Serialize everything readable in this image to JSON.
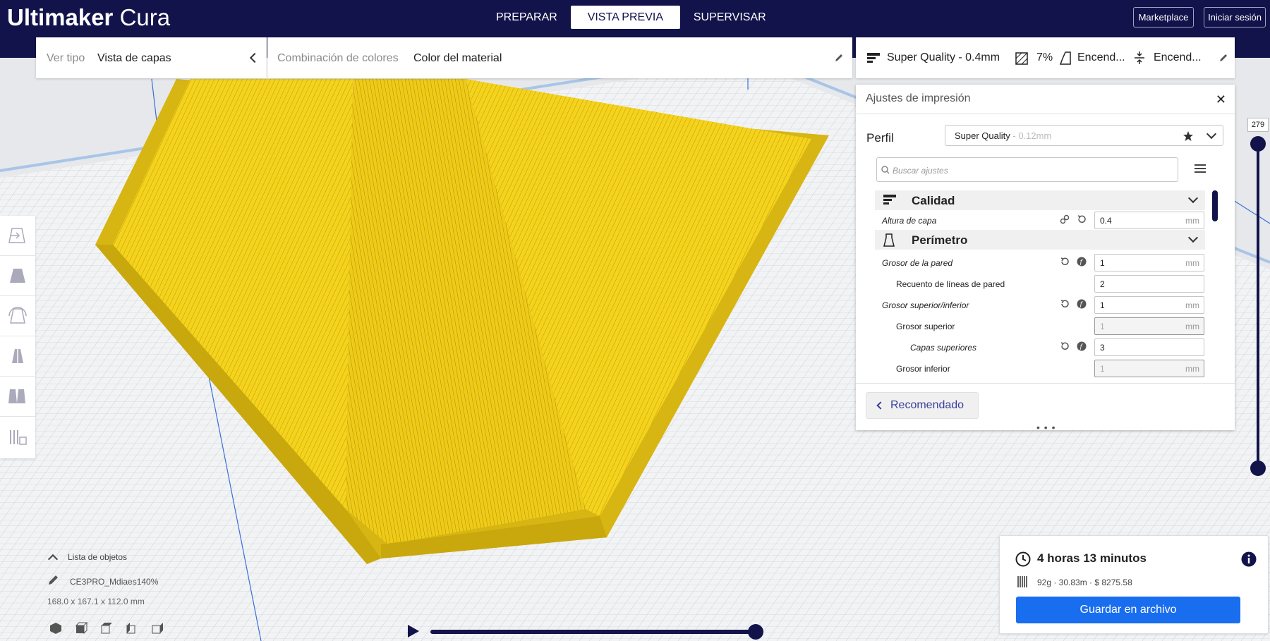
{
  "app": {
    "title_bold": "Ultimaker",
    "title_light": " Cura"
  },
  "stages": [
    {
      "label": "PREPARAR"
    },
    {
      "label": "VISTA PREVIA"
    },
    {
      "label": "SUPERVISAR"
    }
  ],
  "top_buttons": {
    "marketplace": "Marketplace",
    "login": "Iniciar sesión"
  },
  "view": {
    "type_label": "Ver tipo",
    "type_value": "Vista de capas",
    "color_label": "Combinación de colores",
    "color_value": "Color del material"
  },
  "print_setup_bar": {
    "profile": "Super Quality - 0.4mm",
    "infill": "7%",
    "support": "Encend...",
    "adhesion": "Encend..."
  },
  "print_settings": {
    "title": "Ajustes de impresión",
    "profile_label": "Perfil",
    "profile_name": "Super Quality",
    "profile_sub": " - 0.12mm",
    "search_placeholder": "Buscar ajustes",
    "categories": [
      {
        "label": "Calidad"
      },
      {
        "label": "Perímetro"
      }
    ],
    "settings": [
      {
        "label": "Altura de capa",
        "value": "0.4",
        "unit": "mm"
      },
      {
        "label": "Grosor de la pared",
        "value": "1",
        "unit": "mm"
      },
      {
        "label": "Recuento de líneas de pared",
        "value": "2",
        "unit": ""
      },
      {
        "label": "Grosor superior/inferior",
        "value": "1",
        "unit": "mm"
      },
      {
        "label": "Grosor superior",
        "value": "1",
        "unit": "mm"
      },
      {
        "label": "Capas superiores",
        "value": "3",
        "unit": ""
      },
      {
        "label": "Grosor inferior",
        "value": "1",
        "unit": "mm"
      }
    ],
    "recommended_button": "Recomendado"
  },
  "layer_slider": {
    "current_layer": "279"
  },
  "object_list": {
    "toggle_label": "Lista de objetos",
    "object_name": "CE3PRO_Mdiaes140%",
    "dimensions": "168.0 x 167.1 x 112.0 mm"
  },
  "print_info": {
    "time": "4 horas 13 minutos",
    "material": "92g · 30.83m · $ 8275.58",
    "save_button": "Guardar en archivo"
  },
  "colors": {
    "header_bg": "#12134a",
    "accent_blue": "#196ef0",
    "model_yellow": "#f5d31c"
  }
}
